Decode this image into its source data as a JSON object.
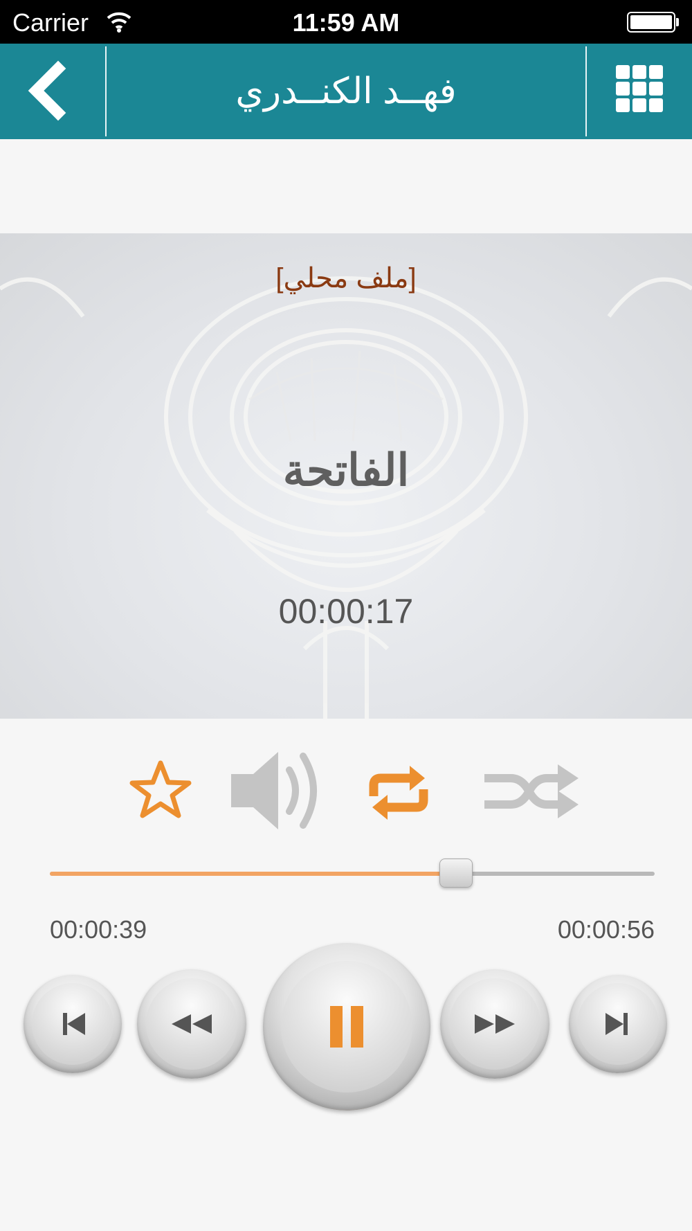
{
  "status_bar": {
    "carrier": "Carrier",
    "time": "11:59 AM"
  },
  "nav": {
    "title": "فهــد الكنــدري",
    "back_icon": "chevron-left-icon",
    "menu_icon": "grid-icon"
  },
  "player": {
    "source_label": "[ملف محلي]",
    "surah_name": "الفاتحة",
    "position_time": "00:00:17",
    "elapsed": "00:00:39",
    "remaining": "00:00:56",
    "progress": 0.67,
    "state": "playing"
  },
  "controls": {
    "favorite_icon": "star-icon",
    "volume_icon": "speaker-icon",
    "repeat_icon": "repeat-icon",
    "shuffle_icon": "shuffle-icon",
    "accent_color": "#ec8f2f",
    "inactive_color": "#c4c4c4"
  },
  "colors": {
    "nav_bg": "#1b8795",
    "source_text": "#8a3a12"
  }
}
